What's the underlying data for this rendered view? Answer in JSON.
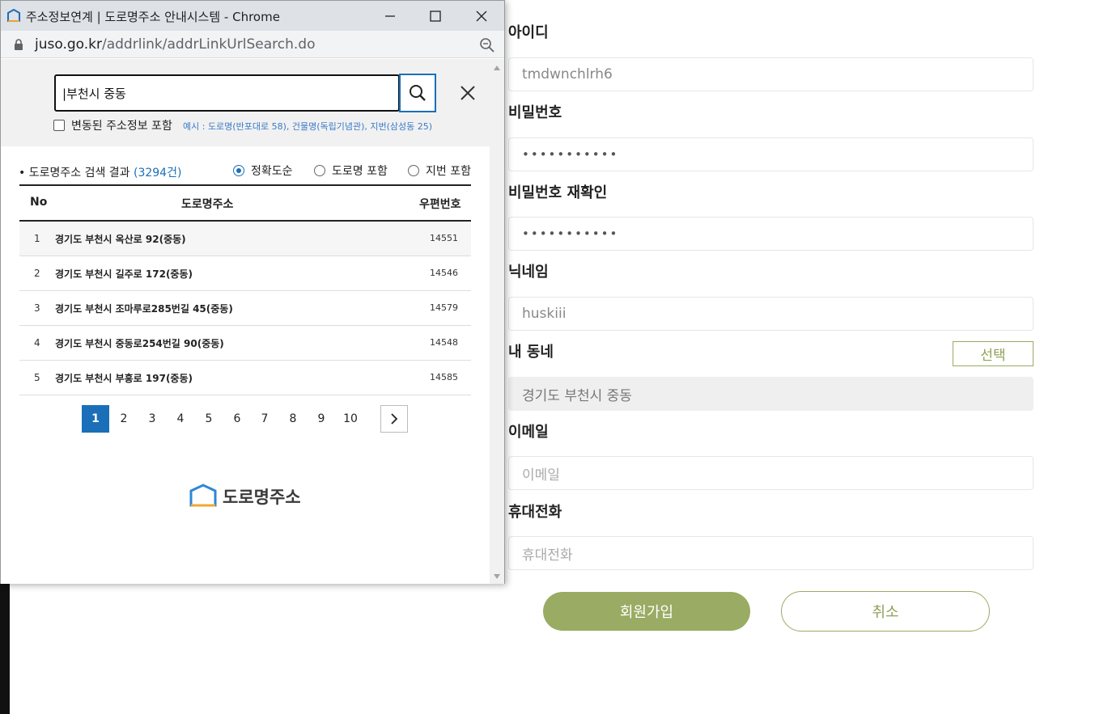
{
  "popup": {
    "window_title": "주소정보연계 | 도로명주소 안내시스템 - Chrome",
    "url_host": "juso.go.kr",
    "url_path": "/addrlink/addrLinkUrlSearch.do",
    "search_value": "|부천시 중동",
    "include_changed_label": "변동된 주소정보 포함",
    "example_text": "예시 : 도로명(반포대로 58), 건물명(독립기념관), 지번(삼성동 25)",
    "result_title": "도로명주소 검색 결과",
    "result_count": "(3294건)",
    "sort_options": [
      {
        "label": "정확도순",
        "selected": true
      },
      {
        "label": "도로명 포함",
        "selected": false
      },
      {
        "label": "지번 포함",
        "selected": false
      }
    ],
    "table": {
      "headers": {
        "no": "No",
        "address": "도로명주소",
        "zip": "우편번호"
      },
      "rows": [
        {
          "no": "1",
          "address": "경기도 부천시 옥산로 92(중동)",
          "zip": "14551"
        },
        {
          "no": "2",
          "address": "경기도 부천시 길주로 172(중동)",
          "zip": "14546"
        },
        {
          "no": "3",
          "address": "경기도 부천시 조마루로285번길 45(중동)",
          "zip": "14579"
        },
        {
          "no": "4",
          "address": "경기도 부천시 중동로254번길 90(중동)",
          "zip": "14548"
        },
        {
          "no": "5",
          "address": "경기도 부천시 부흥로 197(중동)",
          "zip": "14585"
        }
      ]
    },
    "pages": [
      "1",
      "2",
      "3",
      "4",
      "5",
      "6",
      "7",
      "8",
      "9",
      "10"
    ],
    "current_page": "1",
    "logo_text": "도로명주소",
    "accent_color": "#1b6fb8"
  },
  "signup": {
    "id_label": "아이디",
    "id_value": "tmdwnchlrh6",
    "pw_label": "비밀번호",
    "pw_value": "•••••••••••",
    "pw2_label": "비밀번호 재확인",
    "pw2_value": "•••••••••••",
    "nick_label": "닉네임",
    "nick_value": "huskiii",
    "town_label": "내 동네",
    "town_select": "선택",
    "town_value": "경기도 부천시 중동",
    "email_label": "이메일",
    "email_placeholder": "이메일",
    "phone_label": "휴대전화",
    "phone_placeholder": "휴대전화",
    "join_button": "회원가입",
    "cancel_button": "취소",
    "brand_color": "#9aab63"
  }
}
